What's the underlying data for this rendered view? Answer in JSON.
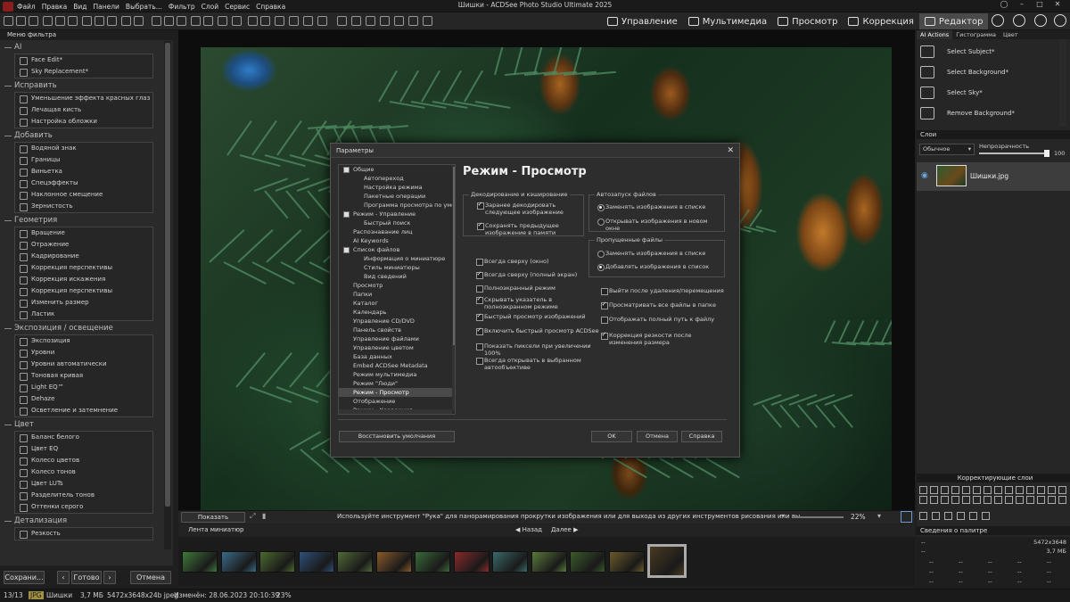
{
  "app": {
    "title": "Шишки - ACDSee Photo Studio Ultimate 2025",
    "menu": [
      "Файл",
      "Правка",
      "Вид",
      "Панели",
      "Выбрать...",
      "Фильтр",
      "Слой",
      "Сервис",
      "Справка"
    ],
    "modes": [
      {
        "label": "Управление",
        "active": false
      },
      {
        "label": "Мультимедиа",
        "active": false
      },
      {
        "label": "Просмотр",
        "active": false
      },
      {
        "label": "Коррекция",
        "active": false
      },
      {
        "label": "Редактор",
        "active": true
      }
    ]
  },
  "left_panel": {
    "title": "Меню фильтра",
    "sections": [
      {
        "title": "AI",
        "items": [
          "Face Edit*",
          "Sky Replacement*"
        ]
      },
      {
        "title": "Исправить",
        "items": [
          "Уменьшение эффекта красных глаз",
          "Лечащая кисть",
          "Настройка обложки"
        ]
      },
      {
        "title": "Добавить",
        "items": [
          "Водяной знак",
          "Границы",
          "Виньетка",
          "Спецэффекты",
          "Наклонное смещение",
          "Зернистость"
        ]
      },
      {
        "title": "Геометрия",
        "items": [
          "Вращение",
          "Отражение",
          "Кадрирование",
          "Коррекция перспективы",
          "Коррекция искажения",
          "Коррекция перспективы",
          "Изменить размер",
          "Ластик"
        ]
      },
      {
        "title": "Экспозиция / освещение",
        "items": [
          "Экспозиция",
          "Уровни",
          "Уровни автоматически",
          "Тоновая кривая",
          "Light EQ™",
          "Dehaze",
          "Осветление и затемнение"
        ]
      },
      {
        "title": "Цвет",
        "items": [
          "Баланс белого",
          "Цвет EQ",
          "Колесо цветов",
          "Колесо тонов",
          "Цвет LUTs",
          "Разделитель тонов",
          "Оттенки серого"
        ]
      },
      {
        "title": "Детализация",
        "items": [
          "Резкость"
        ]
      }
    ],
    "buttons": {
      "save": "Сохрани...",
      "done": "Готово",
      "cancel": "Отмена"
    }
  },
  "viewer": {
    "show_changes": "Показать изменения",
    "hint": "Используйте инструмент \"Рука\" для панорамирования прокрутки изображения или для выхода из других инструментов рисования или вы...",
    "zoom": "22%"
  },
  "filmstrip": {
    "title": "Лента миниатюр",
    "back": "Назад",
    "next": "Далее",
    "thumb_colors": [
      "#3f7a3a",
      "#3a6c8a",
      "#4a6a2e",
      "#2f4f7a",
      "#4f6a38",
      "#8a5a2a",
      "#3a6a3a",
      "#8a2a2a",
      "#3a6a6a",
      "#5a7a3a",
      "#3a5a2a",
      "#6a5a2a",
      "#4a3a22"
    ]
  },
  "status": {
    "count": "13/13",
    "format": "JPG",
    "name": "Шишки",
    "size": "3,7 МБ",
    "dims": "5472x3648x24b jpeg",
    "modified": "Изменён: 28.06.2023 20:10:39",
    "zoom": "23%"
  },
  "right_panel": {
    "tabs": [
      "AI Actions",
      "Гистограмма",
      "Цвет"
    ],
    "ai_actions": [
      "Select Subject*",
      "Select Background*",
      "Select Sky*",
      "Remove Background*"
    ],
    "layers_title": "Слои",
    "blend_mode": "Обычное",
    "opacity_label": "Непрозрачность",
    "opacity_value": "100",
    "layer_name": "Шишки.jpg",
    "adjust_layers_title": "Корректирующие слои",
    "palette_title": "Сведения о палитре",
    "palette_size": "5472x3648",
    "palette_mb": "3,7 МБ",
    "palette_dash": "--"
  },
  "dialog": {
    "title": "Параметры",
    "heading": "Режим - Просмотр",
    "tree": [
      {
        "label": "Общие",
        "level": 0,
        "exp": true
      },
      {
        "label": "Автопереход",
        "level": 1
      },
      {
        "label": "Настройка режима",
        "level": 1
      },
      {
        "label": "Пакетные операции",
        "level": 1
      },
      {
        "label": "Программа просмотра по умо",
        "level": 1
      },
      {
        "label": "Режим - Управление",
        "level": 0,
        "exp": true
      },
      {
        "label": "Быстрый поиск",
        "level": 1
      },
      {
        "label": "Распознавание лиц",
        "level": 0
      },
      {
        "label": "AI Keywords",
        "level": 0
      },
      {
        "label": "Список файлов",
        "level": 0,
        "exp": true
      },
      {
        "label": "Информация о миниатюре",
        "level": 1
      },
      {
        "label": "Стиль миниатюры",
        "level": 1
      },
      {
        "label": "Вид сведений",
        "level": 1
      },
      {
        "label": "Просмотр",
        "level": 0
      },
      {
        "label": "Папки",
        "level": 0
      },
      {
        "label": "Каталог",
        "level": 0
      },
      {
        "label": "Календарь",
        "level": 0
      },
      {
        "label": "Управление CD/DVD",
        "level": 0
      },
      {
        "label": "Панель свойств",
        "level": 0
      },
      {
        "label": "Управление файлами",
        "level": 0
      },
      {
        "label": "Управление цветом",
        "level": 0
      },
      {
        "label": "База данных",
        "level": 0
      },
      {
        "label": "Embed ACDSee Metadata",
        "level": 0
      },
      {
        "label": "Режим мультимедиа",
        "level": 0
      },
      {
        "label": "Режим \"Люди\"",
        "level": 0
      },
      {
        "label": "Режим - Просмотр",
        "level": 0,
        "sel": true
      },
      {
        "label": "Отображение",
        "level": 0
      },
      {
        "label": "Режим - Коррекция",
        "level": 0
      }
    ],
    "decode_group": "Декодирование и кэширование",
    "decode_opts": [
      {
        "label": "Заранее декодировать следующее изображение",
        "on": true
      },
      {
        "label": "Сохранять предыдущее изображение в памяти",
        "on": true
      }
    ],
    "autorun_group": "Автозапуск файлов",
    "autorun_opts": [
      {
        "label": "Заменять изображения в списке",
        "on": true
      },
      {
        "label": "Открывать изображения в новом окне",
        "on": false
      }
    ],
    "skipped_group": "Пропущенные файлы",
    "skipped_opts": [
      {
        "label": "Заменять изображения в списке",
        "on": false
      },
      {
        "label": "Добавлять изображения в список",
        "on": true
      }
    ],
    "left_checks": [
      {
        "label": "Всегда сверху (окно)",
        "on": false
      },
      {
        "label": "Всегда сверху (полный экран)",
        "on": true
      },
      {
        "label": "Полноэкранный режим",
        "on": false
      },
      {
        "label": "Скрывать указатель в полноэкранном режиме",
        "on": true
      },
      {
        "label": "Быстрый просмотр изображений",
        "on": true
      },
      {
        "label": "Включить быстрый просмотр ACDSee",
        "on": true
      },
      {
        "label": "Показать пиксели при увеличении 100%",
        "on": false
      },
      {
        "label": "Всегда открывать в выбранном автообъективе",
        "on": false
      }
    ],
    "right_checks": [
      {
        "label": "Выйти после удаления/перемещения",
        "on": false
      },
      {
        "label": "Просматривать все файлы в папке",
        "on": true
      },
      {
        "label": "Отображать полный путь к файлу",
        "on": false
      },
      {
        "label": "Коррекция резкости после изменения размера",
        "on": true
      }
    ],
    "buttons": {
      "restore": "Восстановить умолчания",
      "ok": "OK",
      "cancel": "Отмена",
      "help": "Справка"
    }
  }
}
